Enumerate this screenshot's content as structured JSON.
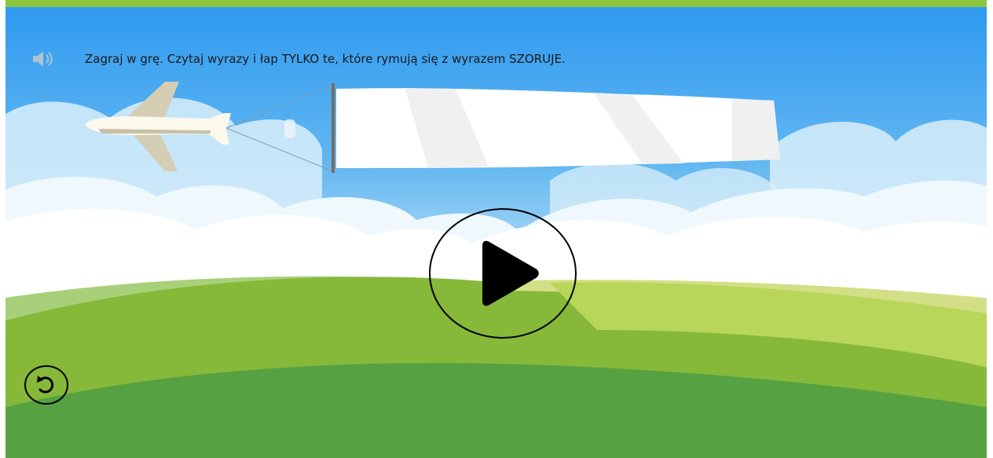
{
  "game": {
    "instruction": "Zagraj w grę. Czytaj wyrazy i łap TYLKO te, które rymują się z wyrazem SZORUJE.",
    "banner_word": ""
  },
  "icons": {
    "audio": "speaker-icon",
    "play": "play-icon",
    "restart": "restart-icon",
    "plane": "airplane-icon"
  },
  "colors": {
    "top_bar": "#8cc63f",
    "sky_top": "#2f9af0",
    "sky_bottom": "#bfe3f7",
    "cloud": "#ffffff",
    "grass_light": "#b8d65a",
    "grass_mid": "#86b83a",
    "grass_dark": "#56a142"
  }
}
